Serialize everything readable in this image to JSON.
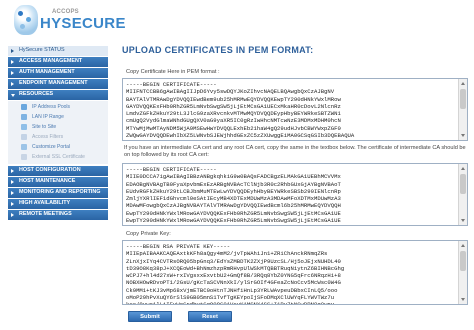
{
  "brand": {
    "company": "ACCOPS",
    "product": "HYSECURE"
  },
  "colors": {
    "accent": "#3a86c9",
    "menu_bg": "#2f6db1",
    "title": "#2d5f9a"
  },
  "sidebar": {
    "items": [
      {
        "label": "HySecure STATUS",
        "style": "plain"
      },
      {
        "label": "ACCESS MANAGEMENT"
      },
      {
        "label": "AUTH MANAGEMENT"
      },
      {
        "label": "ENDPOINT MANAGEMENT"
      },
      {
        "label": "RESOURCES"
      }
    ],
    "subitems": [
      {
        "label": "IP Address Pools",
        "icon": "network-icon"
      },
      {
        "label": "LAN IP Range",
        "icon": "lan-icon"
      },
      {
        "label": "Site to Site",
        "icon": "site-icon"
      },
      {
        "label": "Access Filters",
        "icon": "filter-icon"
      },
      {
        "label": "Customize Portal",
        "icon": "portal-icon"
      },
      {
        "label": "External SSL Certificate",
        "icon": "certificate-icon"
      }
    ],
    "items_after": [
      {
        "label": "HOST CONFIGURATION"
      },
      {
        "label": "HOST MAINTENANCE"
      },
      {
        "label": "MONITORING AND REPORTING"
      },
      {
        "label": "HIGH AVAILABILITY"
      },
      {
        "label": "REMOTE MEETINGS"
      }
    ]
  },
  "main": {
    "title": "UPLOAD CERTIFICATES IN PEM FORMAT:",
    "cert_label": "Copy Certificate Here in PEM format :",
    "cert_value": "-----BEGIN CERTIFICATE-----\nMIIFNTCCBB6gAwIBAgIIJpD6Yvy5swDQYJKoZIhvcNAQELBQAwgbQxCzAJBgNV\nBAYTAlVTMRAwDgYDVQQIEwdBem9ub25hMRMwEQYDVQQKEwpTY290dHNkYWxlMRow\nGAYDVQQKExFHb0RhZGR5LmNvbSwgSW5jLjEtMCsGA1UECxMkaHR0cDovL2NlcnRz\nLmdvZGFkZHkuY29tL3JlcG9zaXRvcnkvMTMwMQYDVQQDEypHbyBEYWRkeSBTZWN1\ncmUgQ2VydGlmaWNhdGUgQXV0aG9yaXR5IC0gRzIwHhcNMTcwNzE3MDMxMDHM0hcN\nMTYwMjMwMTAyNDM5WjA9MSEwHwYDVQQLExhEb21haW4gQ29udHJvbCBWYWxpZGF0\nZWQwGAYDVQQDEwhIbXZ5LWNvbSJEWjhhdGExZC5zZXUwggEiMA0GCSqGSIb3DQEBAQUA",
    "chain_label": "If you have an intermediate CA cert and any root CA cert, copy the same in the textbox below. The certificate of intermediate CA should be on top followed by its root CA cert:",
    "chain_value": "-----BEGIN CERTIFICATE-----\nMIIE0DCCA7igAwIBAgIBBzANBgkqhkiG9w0BAQsFADCBgzELMAkGA1UEBhMCVVMx\nEDAOBgNVBAgTB0FyaXpvbmExEzARBgNVBAcTClNjb3R0c2RhbGUxGjAYBgNVBAoT\nEUdvRGFkZHkuY29tLCBJbmMuMTEwLwYDVQQDEyhHbyBEYWRkeSBSb290IENlcnRp\nZmljYXRlIEF1dGhvcml0eSAtIEcyMB4XDTExMDUwMzA3MDAwMFoXDTMxMDUwMzA3\nMDAwMFowgbQxCzAJBgNVBAYTAlVTMRAwDgYDVQQIEwdBcml6b25hMRMwEQYDVQQH\nEwpTY290dHNkYWxlMRowGAYDVQQKExFHb0RhZGR5LmNvbSwgSW5jLjEtMCsGA1UE\nEwpTY290dHNkYWxlMRowGAYDVQQKExFHb0RhZGR5LmNvbSwgSW5jLjEtMCsGA1UE",
    "key_label": "Copy Private Key:",
    "key_value": "-----BEGIN RSA PRIVATE KEY-----\nMIIEpAIBAAKCAQEAxtkKFh8aQgy4mM2/jvTpWAhiJn1+ZRiChAnckRNmqZRs\nZLnXjxIYq4CVTRsORQ05bpGnq3/EdYsZMBDTK2ZXjP9UzcSL/Hj5oJEjxNUHDL40\ntD39O8Kq38pJ+XCQEoWd+BhNmzhzpRmRHvpUlWSkMTQBBTRuqNiytnZ6BIHNBcGhg\nwCPJ7+hl4d27xW+rxIVgsxxExvtbU2+GmQf8B/3RQq8YbZ0YNG5qFrc6NRqzHi+8\nNOBXHOwRDvoPT1/2GsU/gKcTaSCVNnXkI/ylSrGOIf4GFeaZcNoCcv5McWsc0W4G\nCk9MM1+tKJ3vMp68xVjmETBC0oHtnTJNHfiHnLp3YRLWAvpeuDBbxCInLQ5/ooo\noMoP29hPvXuQY6rSlS9GB05mnS1TvfTgKEYpoIjSFoDMqXClUWYqFLYWVTWz7u\nkxc/Ouwo1lLiIEyWoGrdbvtGqQ0QG01VcyK1MSNX4SS+I1Pu7tNGwBRN8q0wpv\nqUyK7ORJvnsSVl13f1o3PLj8/bMDQNfIk1xhEBVjvEqC9gEzPJyRk0qjLatQ"
  },
  "buttons": {
    "submit": "Submit",
    "reset": "Reset"
  }
}
